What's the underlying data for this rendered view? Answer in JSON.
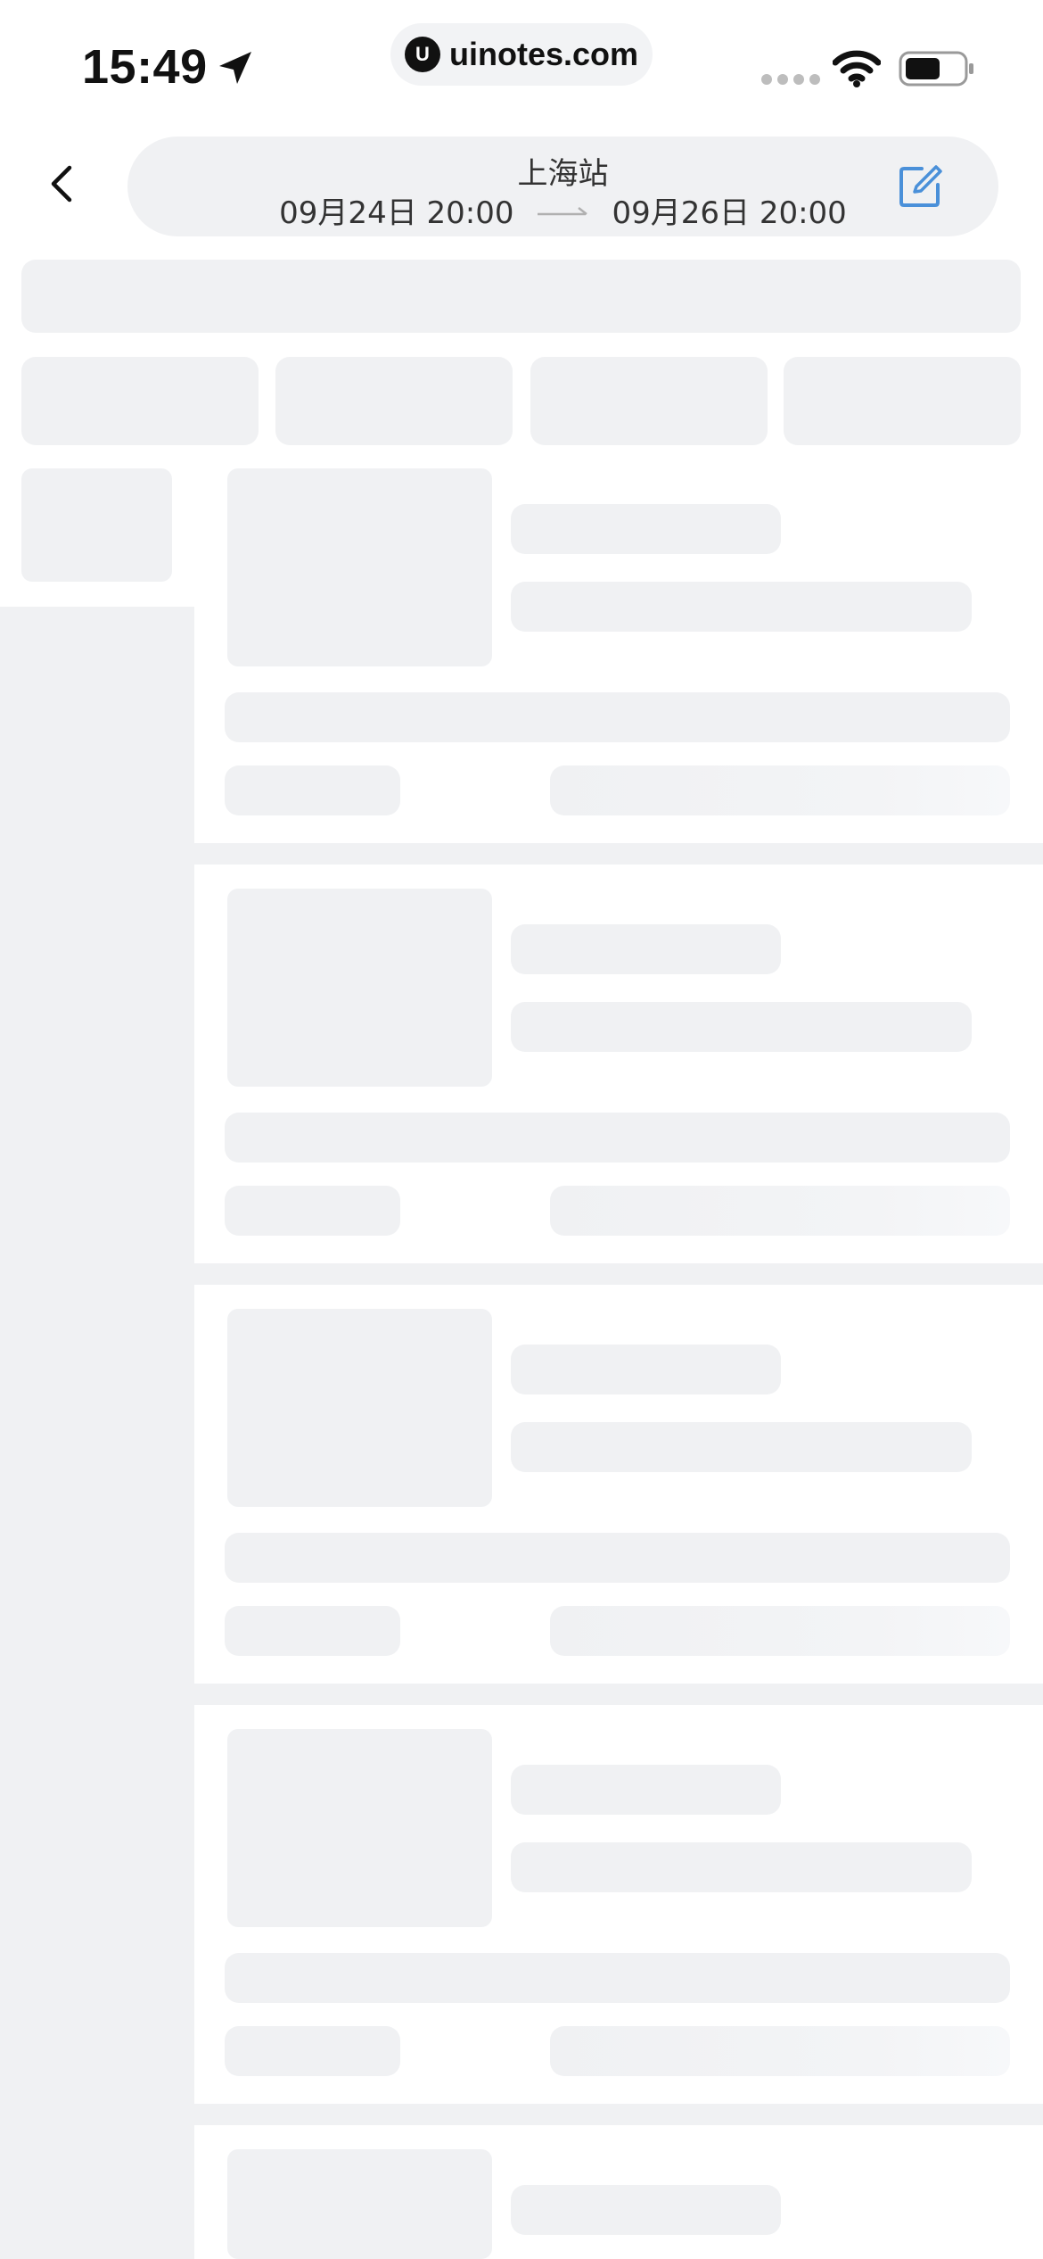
{
  "status_bar": {
    "time": "15:49",
    "url_logo": "U",
    "url": "uinotes.com",
    "icons": [
      "location-arrow-icon",
      "signal-dots-icon",
      "wifi-icon",
      "battery-icon"
    ]
  },
  "header": {
    "back_icon": "chevron-left-icon",
    "station": "上海站",
    "start": "09月24日 20:00",
    "end": "09月26日 20:00",
    "arrow_icon": "arrow-right-icon",
    "edit_icon": "edit-icon"
  },
  "loading_state": {
    "visible_result_cards": 5
  },
  "colors": {
    "skeleton": "#f0f1f3",
    "edit_icon": "#4a90d9",
    "background": "#ffffff"
  }
}
